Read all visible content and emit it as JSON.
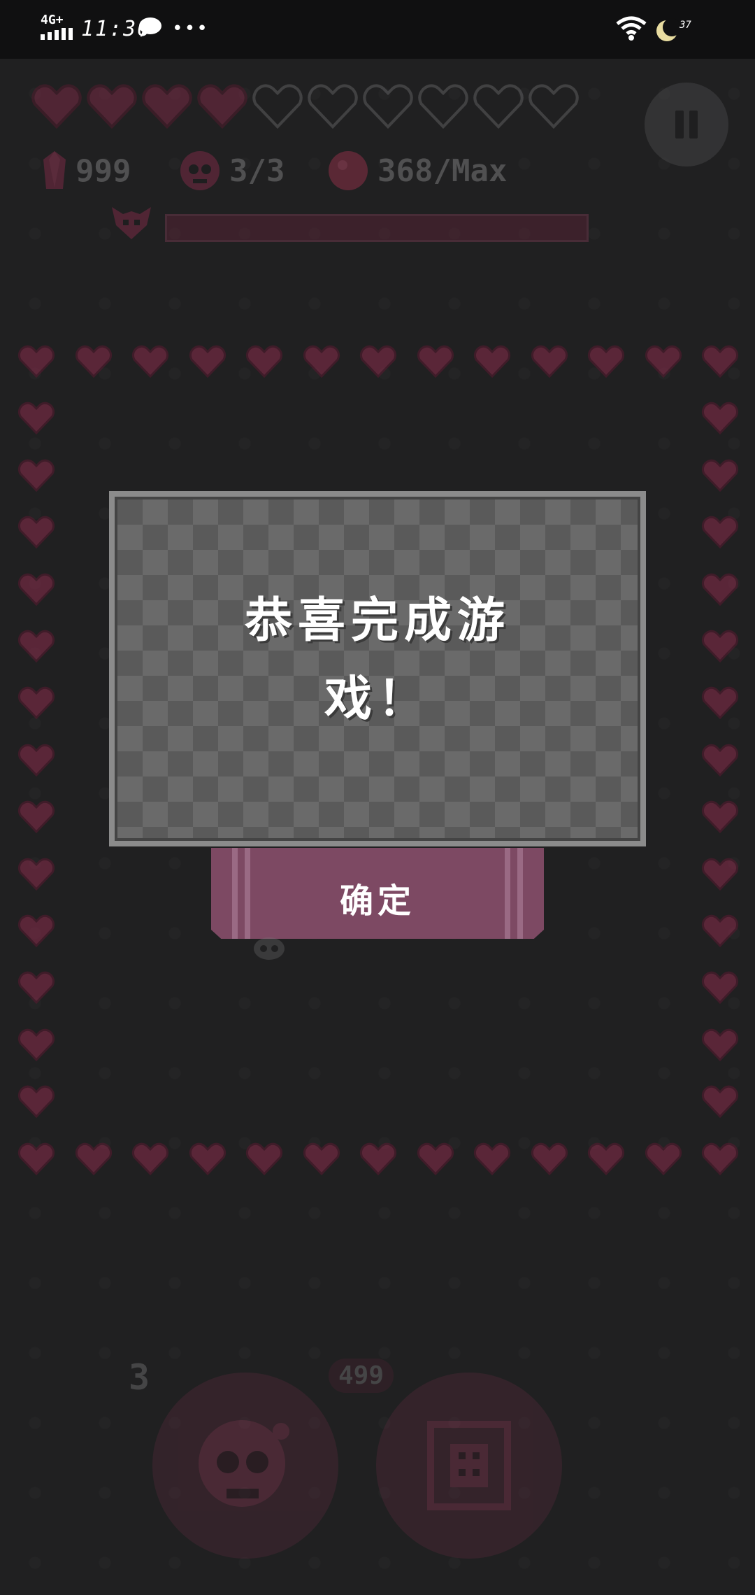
{
  "status_bar": {
    "network": "4G+",
    "time": "11:36",
    "more": "•••",
    "battery": "37"
  },
  "hud": {
    "hearts_total": 10,
    "hearts_filled": 4,
    "gems": "999",
    "skulls": "3/3",
    "orbs": "368/Max",
    "boss_progress": 1.0
  },
  "dialog": {
    "message_line1": "恭喜完成游",
    "message_line2": "戏！",
    "confirm_label": "确定"
  },
  "bottom": {
    "skill_count": "3",
    "skill_cost": "499"
  },
  "colors": {
    "heart": "#8a2c4c",
    "button": "#7d4963",
    "dialog_bg": "#5a5a5a"
  }
}
